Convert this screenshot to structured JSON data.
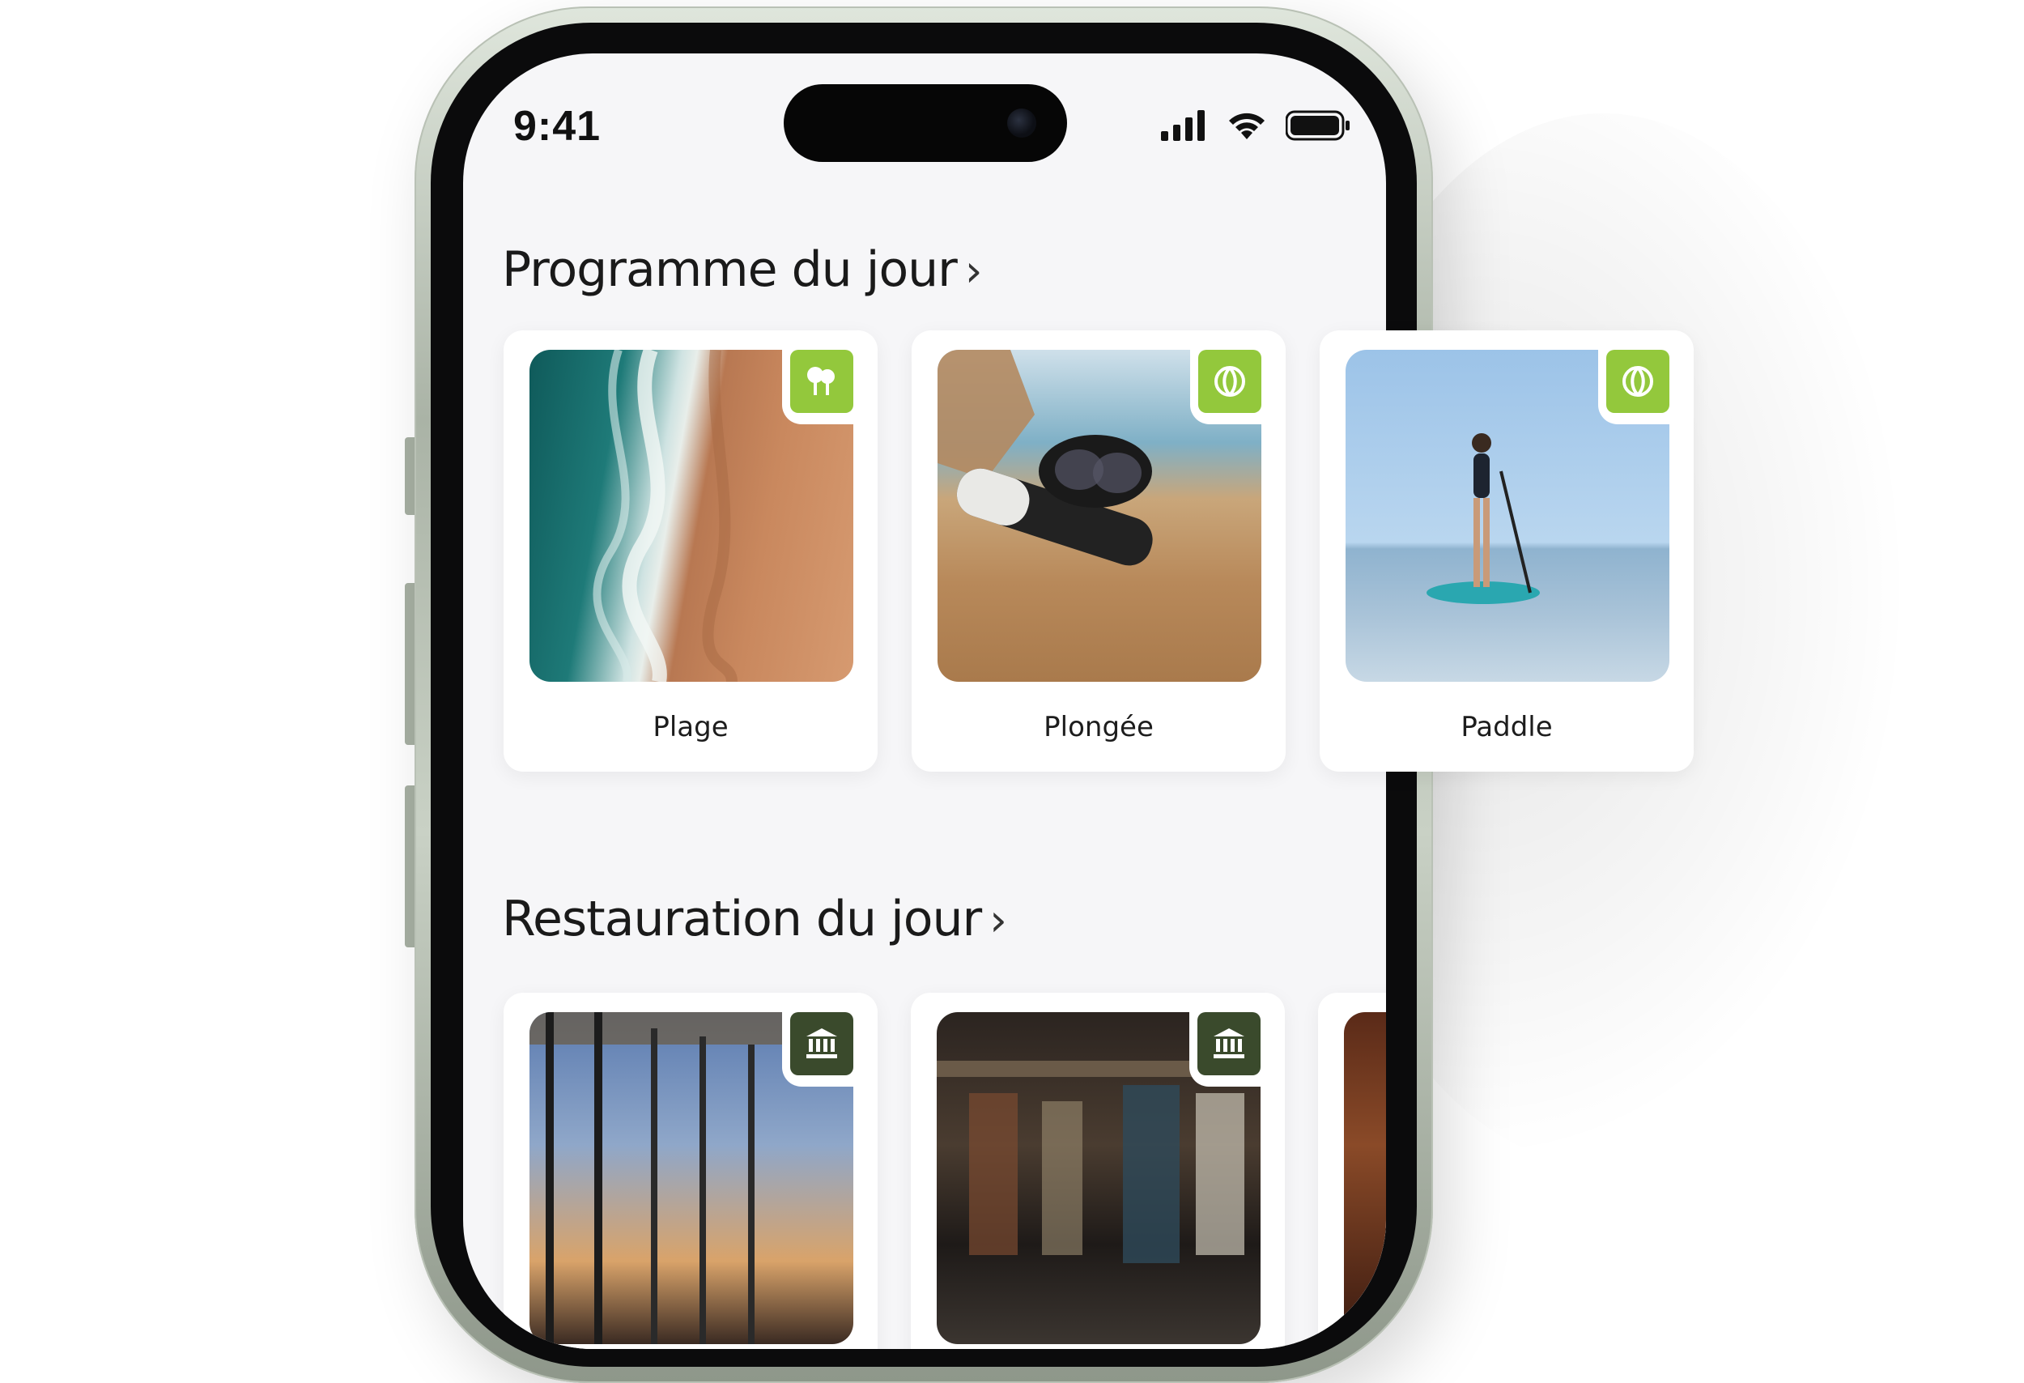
{
  "status_bar": {
    "time": "9:41"
  },
  "sections": [
    {
      "title": "Programme du jour",
      "chevron": "›",
      "cards": [
        {
          "label": "Plage",
          "badge_icon": "palm-trees-icon",
          "badge_color": "#93c83c"
        },
        {
          "label": "Plongée",
          "badge_icon": "beach-ball-icon",
          "badge_color": "#93c83c"
        },
        {
          "label": "Paddle",
          "badge_icon": "beach-ball-icon",
          "badge_color": "#93c83c"
        }
      ]
    },
    {
      "title": "Restauration du jour",
      "chevron": "›",
      "cards": [
        {
          "badge_icon": "institution-icon",
          "badge_color": "#3a4a2c"
        },
        {
          "badge_icon": "institution-icon",
          "badge_color": "#3a4a2c"
        }
      ]
    }
  ],
  "colors": {
    "accent_lime": "#93c83c",
    "accent_dark": "#3a4a2c",
    "screen_bg": "#f6f6f8"
  }
}
